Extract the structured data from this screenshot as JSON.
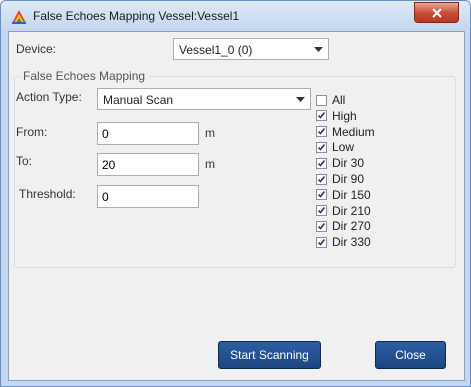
{
  "window": {
    "title": "False Echoes Mapping Vessel:Vessel1"
  },
  "device": {
    "label": "Device:",
    "value": "Vessel1_0 (0)"
  },
  "group": {
    "title": "False Echoes Mapping",
    "action_type_label": "Action Type:",
    "action_type_value": "Manual Scan",
    "from_label": "From:",
    "from_value": "0",
    "from_unit": "m",
    "to_label": "To:",
    "to_value": "20",
    "to_unit": "m",
    "threshold_label": "Threshold:",
    "threshold_value": "0"
  },
  "checkboxes": [
    {
      "label": "All",
      "checked": false
    },
    {
      "label": "High",
      "checked": true
    },
    {
      "label": "Medium",
      "checked": true
    },
    {
      "label": "Low",
      "checked": true
    },
    {
      "label": "Dir 30",
      "checked": true
    },
    {
      "label": "Dir 90",
      "checked": true
    },
    {
      "label": "Dir 150",
      "checked": true
    },
    {
      "label": "Dir 210",
      "checked": true
    },
    {
      "label": "Dir 270",
      "checked": true
    },
    {
      "label": "Dir 330",
      "checked": true
    }
  ],
  "buttons": {
    "start": "Start Scanning",
    "close": "Close"
  }
}
